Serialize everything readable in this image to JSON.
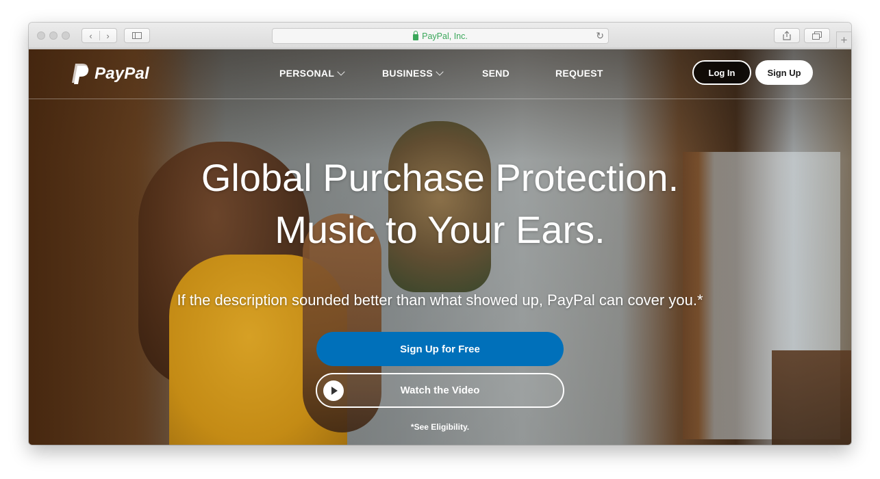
{
  "browser": {
    "address": "PayPal, Inc."
  },
  "nav": {
    "brand": "PayPal",
    "items": [
      {
        "label": "PERSONAL"
      },
      {
        "label": "BUSINESS"
      },
      {
        "label": "SEND"
      },
      {
        "label": "REQUEST"
      }
    ],
    "login_label": "Log In",
    "signup_label": "Sign Up"
  },
  "hero": {
    "headline_line1": "Global Purchase Protection.",
    "headline_line2": "Music to Your Ears.",
    "subheadline": "If the description sounded better than what showed up, PayPal can cover you.*",
    "primary_cta": "Sign Up for Free",
    "video_cta": "Watch the Video",
    "footnote": "*See Eligibility."
  },
  "colors": {
    "brand_blue": "#0070ba",
    "secure_green": "#3aa75a"
  }
}
